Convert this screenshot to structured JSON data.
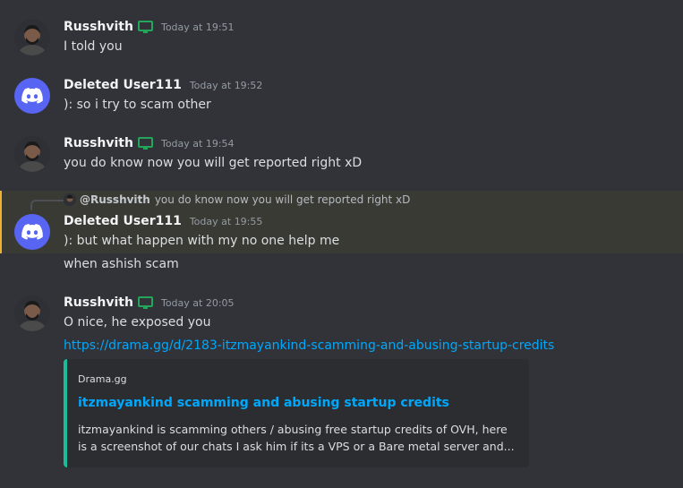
{
  "colors": {
    "background": "#313338",
    "link": "#00a8fc",
    "online_green": "#23a55a",
    "mention_highlight": "#f0b132",
    "embed_accent": "#1abc9c",
    "discord_blurple": "#5865f2"
  },
  "messages": [
    {
      "author": "Russhvith",
      "avatar": "user-avatar-photo",
      "status_icon": "desktop-icon",
      "timestamp": "Today at 19:51",
      "lines": [
        "I told you"
      ]
    },
    {
      "author": "Deleted User111",
      "avatar": "discord-logo",
      "timestamp": "Today at 19:52",
      "lines": [
        "): so i try to scam other"
      ]
    },
    {
      "author": "Russhvith",
      "avatar": "user-avatar-photo",
      "status_icon": "desktop-icon",
      "timestamp": "Today at 19:54",
      "lines": [
        "you do know now you will get reported right xD"
      ]
    },
    {
      "author": "Deleted User111",
      "avatar": "discord-logo",
      "timestamp": "Today at 19:55",
      "reply_to": {
        "author": "@Russhvith",
        "text": "you do know now you will get reported right xD"
      },
      "lines": [
        "): but what happen with my no one help me",
        "when ashish scam"
      ]
    },
    {
      "author": "Russhvith",
      "avatar": "user-avatar-photo",
      "status_icon": "desktop-icon",
      "timestamp": "Today at 20:05",
      "lines": [
        "O nice, he exposed you"
      ],
      "link": "https://drama.gg/d/2183-itzmayankind-scamming-and-abusing-startup-credits",
      "embed": {
        "site": "Drama.gg",
        "title": "itzmayankind scamming and abusing startup credits",
        "description": "itzmayankind is scamming others / abusing free startup credits of OVH, here is a screenshot of our chats I ask him if its a VPS or a Bare metal server and..."
      }
    }
  ]
}
